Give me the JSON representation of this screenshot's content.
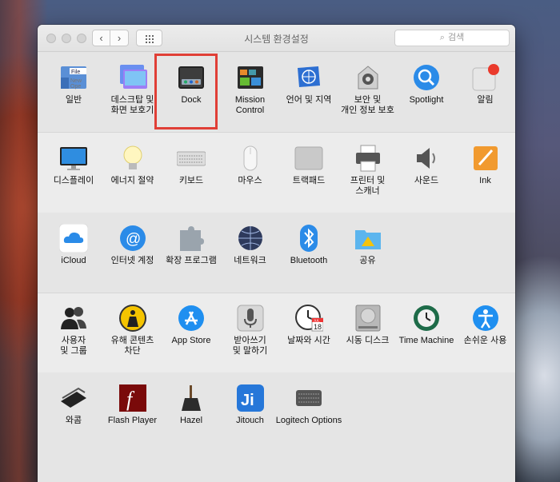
{
  "window": {
    "title": "시스템 환경설정"
  },
  "nav": {
    "back": "‹",
    "forward": "›"
  },
  "search": {
    "placeholder": "검색"
  },
  "rows": [
    [
      {
        "label": "일반",
        "icon": "general-icon"
      },
      {
        "label": "데스크탑 및\n화면 보호기",
        "icon": "desktop-screensaver-icon"
      },
      {
        "label": "Dock",
        "icon": "dock-icon"
      },
      {
        "label": "Mission\nControl",
        "icon": "mission-control-icon"
      },
      {
        "label": "언어 및 지역",
        "icon": "language-region-icon"
      },
      {
        "label": "보안 및\n개인 정보 보호",
        "icon": "security-privacy-icon"
      },
      {
        "label": "Spotlight",
        "icon": "spotlight-icon"
      },
      {
        "label": "알림",
        "icon": "notifications-icon"
      }
    ],
    [
      {
        "label": "디스플레이",
        "icon": "displays-icon"
      },
      {
        "label": "에너지 절약",
        "icon": "energy-saver-icon"
      },
      {
        "label": "키보드",
        "icon": "keyboard-icon"
      },
      {
        "label": "마우스",
        "icon": "mouse-icon"
      },
      {
        "label": "트랙패드",
        "icon": "trackpad-icon"
      },
      {
        "label": "프린터 및\n스캐너",
        "icon": "printers-scanners-icon"
      },
      {
        "label": "사운드",
        "icon": "sound-icon"
      },
      {
        "label": "Ink",
        "icon": "ink-icon"
      }
    ],
    [
      {
        "label": "iCloud",
        "icon": "icloud-icon"
      },
      {
        "label": "인터넷 계정",
        "icon": "internet-accounts-icon"
      },
      {
        "label": "확장 프로그램",
        "icon": "extensions-icon"
      },
      {
        "label": "네트워크",
        "icon": "network-icon"
      },
      {
        "label": "Bluetooth",
        "icon": "bluetooth-icon"
      },
      {
        "label": "공유",
        "icon": "sharing-icon"
      }
    ],
    [
      {
        "label": "사용자\n및 그룹",
        "icon": "users-groups-icon"
      },
      {
        "label": "유해 콘텐츠\n차단",
        "icon": "parental-controls-icon"
      },
      {
        "label": "App Store",
        "icon": "app-store-icon"
      },
      {
        "label": "받아쓰기\n및 말하기",
        "icon": "dictation-speech-icon"
      },
      {
        "label": "날짜와 시간",
        "icon": "date-time-icon"
      },
      {
        "label": "시동 디스크",
        "icon": "startup-disk-icon"
      },
      {
        "label": "Time Machine",
        "icon": "time-machine-icon"
      },
      {
        "label": "손쉬운 사용",
        "icon": "accessibility-icon"
      }
    ],
    [
      {
        "label": "와콤",
        "icon": "wacom-icon"
      },
      {
        "label": "Flash Player",
        "icon": "flash-player-icon"
      },
      {
        "label": "Hazel",
        "icon": "hazel-icon"
      },
      {
        "label": "Jitouch",
        "icon": "jitouch-icon"
      },
      {
        "label": "Logitech Options",
        "icon": "logitech-options-icon"
      }
    ]
  ],
  "icon_text": {
    "general_file": "File",
    "general_new": "New",
    "general_open": "Ope",
    "date_month": "JUL",
    "date_day": "18",
    "flash": "f",
    "jitouch": "Ji"
  }
}
